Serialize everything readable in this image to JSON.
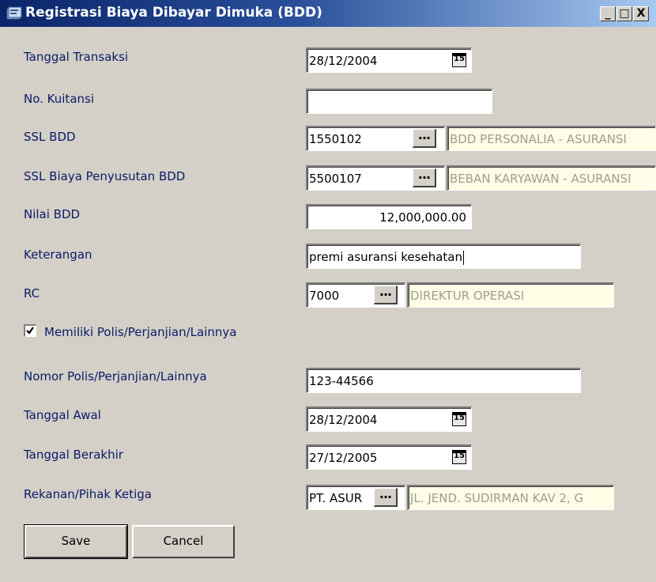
{
  "window": {
    "title": "Registrasi Biaya Dibayar Dimuka (BDD)",
    "controls": [
      "_",
      "□",
      "X"
    ]
  },
  "form": {
    "tanggal_transaksi": {
      "label": "Tanggal Transaksi",
      "value": "28/12/2004"
    },
    "no_kuitansi": {
      "label": "No. Kuitansi",
      "value": ""
    },
    "ssl_bdd": {
      "label": "SSL BDD",
      "code": "1550102",
      "description": "BDD PERSONALIA - ASURANSI"
    },
    "ssl_biaya": {
      "label": "SSL Biaya Penyusutan BDD",
      "code": "5500107",
      "description": "BEBAN KARYAWAN - ASURANSI"
    },
    "nilai_bdd": {
      "label": "Nilai BDD",
      "value": "12,000,000.00"
    },
    "keterangan": {
      "label": "Keterangan",
      "value": "premi asuransi kesehatan"
    },
    "rc": {
      "label": "RC",
      "code": "7000",
      "description": "DIREKTUR OPERASI"
    },
    "memiliki_polis": {
      "label": "Memiliki Polis/Perjanjian/Lainnya",
      "checked": true
    },
    "nomor_polis": {
      "label": "Nomor Polis/Perjanjian/Lainnya",
      "value": "123-44566"
    },
    "tanggal_awal": {
      "label": "Tanggal Awal",
      "value": "28/12/2004"
    },
    "tanggal_berakhir": {
      "label": "Tanggal Berakhir",
      "value": "27/12/2005"
    },
    "rekanan": {
      "label": "Rekanan/Pihak Ketiga",
      "code": "PT. ASUR",
      "description": "JL. JEND. SUDIRMAN KAV 2, G"
    }
  },
  "buttons": {
    "save": "Save",
    "cancel": "Cancel"
  },
  "icons": {
    "lookup": "...",
    "calendar": "15"
  },
  "colors": {
    "title_start": "#0a246a",
    "title_end": "#a6caf0",
    "face": "#d4d0c8",
    "label": "#0a1a66",
    "readonly_bg": "#fffde6"
  }
}
